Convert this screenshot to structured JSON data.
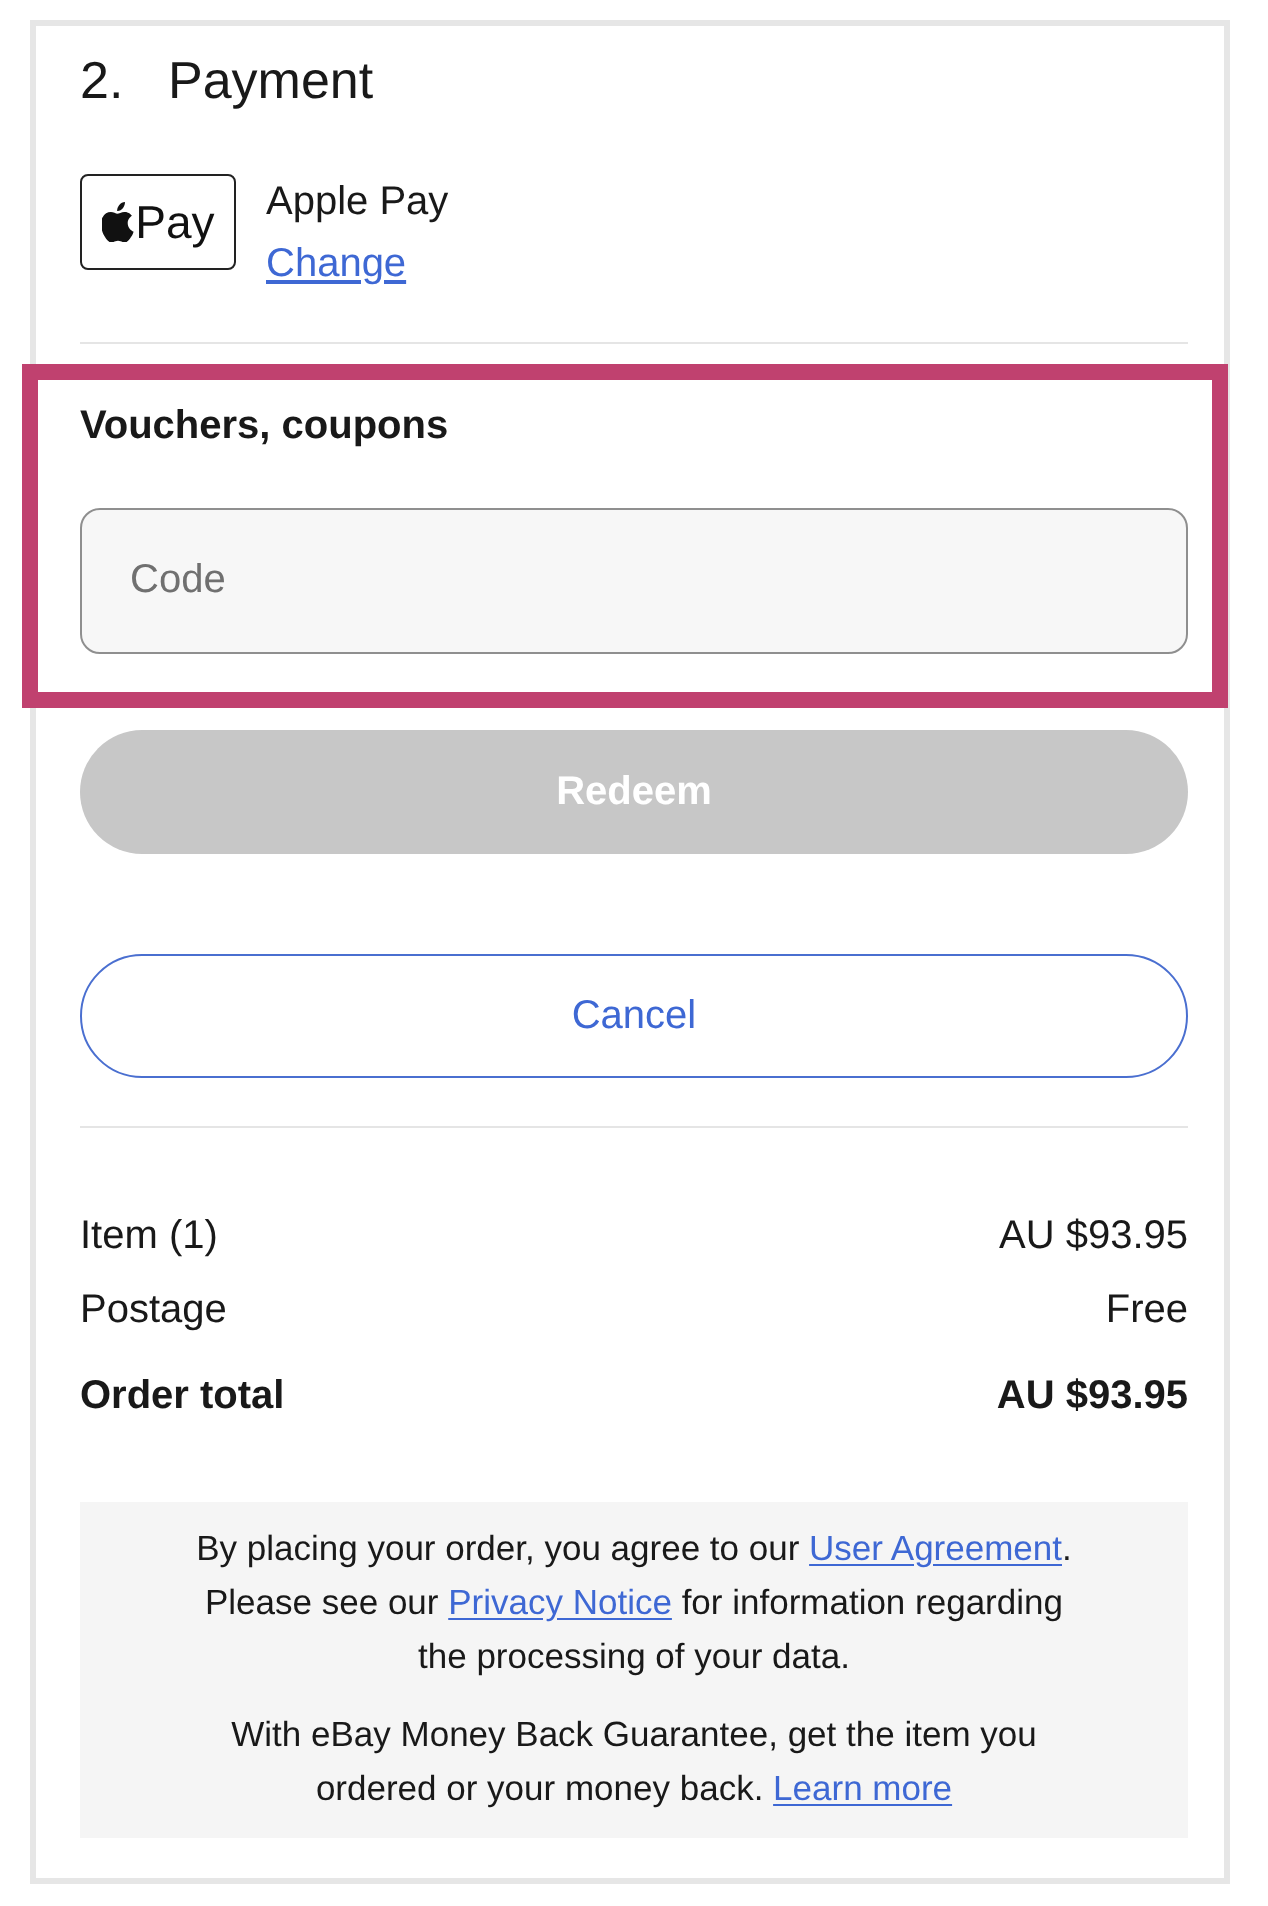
{
  "section": {
    "number": "2.",
    "title": "Payment"
  },
  "payment_method": {
    "logo_text": "Pay",
    "name": "Apple Pay",
    "change_link": "Change"
  },
  "vouchers": {
    "label": "Vouchers, coupons",
    "highlighted": true,
    "code_field": {
      "placeholder": "Code"
    }
  },
  "buttons": [
    {
      "label": "Redeem",
      "kind": "primary",
      "disabled": true
    },
    {
      "label": "Cancel",
      "kind": "secondary",
      "disabled": false
    }
  ],
  "summary": [
    {
      "label": "Item (1)",
      "value": "AU $93.95",
      "emphasis": false
    },
    {
      "label": "Postage",
      "value": "Free",
      "emphasis": false
    },
    {
      "label": "Order total",
      "value": "AU $93.95",
      "emphasis": true
    }
  ],
  "legal": [
    {
      "parts": [
        {
          "kind": "text",
          "text": "By placing your order, you agree to our "
        },
        {
          "kind": "link",
          "text": "User Agreement"
        },
        {
          "kind": "text",
          "text": ".\nPlease see our "
        },
        {
          "kind": "link",
          "text": "Privacy Notice"
        },
        {
          "kind": "text",
          "text": " for information regarding\nthe processing of your data."
        }
      ]
    },
    {
      "parts": [
        {
          "kind": "text",
          "text": "With eBay Money Back Guarantee, get the item you\nordered or your money back. "
        },
        {
          "kind": "link",
          "text": "Learn more"
        }
      ]
    }
  ]
}
